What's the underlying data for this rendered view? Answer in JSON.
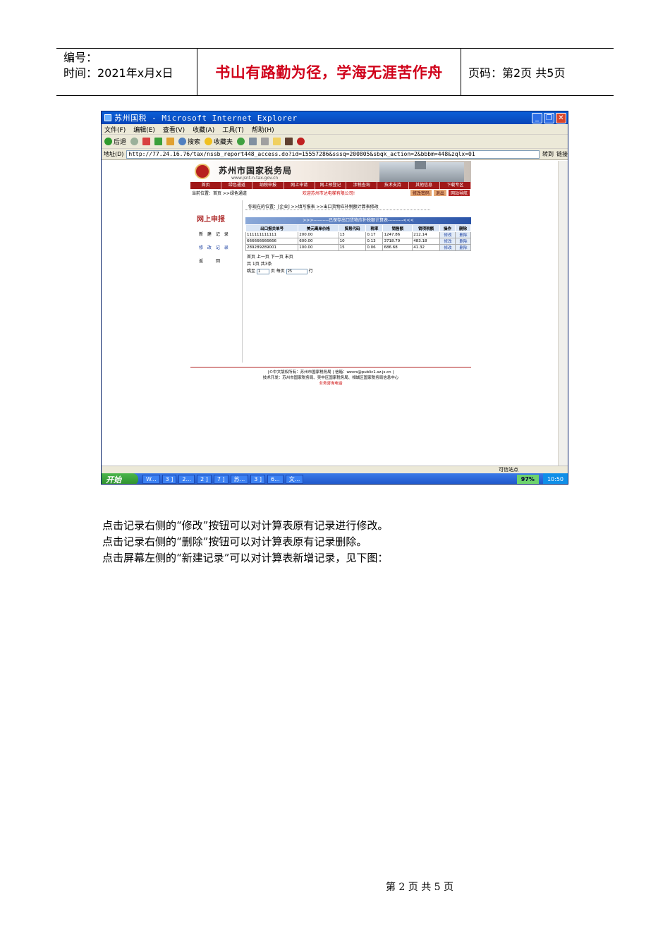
{
  "header": {
    "number_label": "编号：",
    "time_label": "时间：2021年x月x日",
    "motto": "书山有路勤为径，学海无涯苦作舟",
    "page_label": "页码：第2页  共5页"
  },
  "browser": {
    "title": "苏州国税 - Microsoft Internet Explorer",
    "menu": [
      "文件(F)",
      "编辑(E)",
      "查看(V)",
      "收藏(A)",
      "工具(T)",
      "帮助(H)"
    ],
    "toolbar": {
      "back": "后退",
      "search": "搜索",
      "favorites": "收藏夹"
    },
    "address_label": "地址(D)",
    "address": "http://77.24.16.76/tax/nssb_report448_access.do?id=15557286&sssq=200805&sbqk_action=2&bbbm=448&zqlx=01",
    "go_label": "转到",
    "links_label": "链接",
    "status": "可信站点",
    "taskbar": {
      "start": "开始",
      "items": [
        "W...",
        "3 ]",
        "2...",
        "2 ]",
        "7 ]",
        "苏...",
        "3 ]",
        "6...",
        "文..."
      ],
      "zoom": "97%",
      "clock": "10:50"
    }
  },
  "site": {
    "name": "苏州市国家税务局",
    "url": "www.jsnt-n-tax.gov.cn",
    "nav": [
      "首页",
      "绿色通道",
      "纳税申报",
      "网上申请",
      "网上预登记",
      "涉税查询",
      "技术支持",
      "其他信息",
      "下载专区"
    ],
    "location": "当前位置：首页 >>绿色通道",
    "welcome": "欢迎苏州市达电梯有限公司!",
    "btn_modify_pwd": "修改密码",
    "btn_exit": "退出",
    "btn_site_nav": "网站导航",
    "side_title": "网上申报",
    "side_links": [
      "新 建 记 录",
      "修 改 记 录",
      "返　　回"
    ],
    "crumb": "你现在的位置：[企业] >>填写报表 >>出口货物应补税额计算表修改",
    "table_title": ">>>----------已保存出口货物应补税额计算表----------<<<",
    "columns": [
      "出口报关单号",
      "美元离岸价格",
      "贸易代码",
      "税率",
      "销售额",
      "销项税额",
      "操作",
      "删除"
    ],
    "rows": [
      [
        "111111111111",
        "200.00",
        "13",
        "0.17",
        "1247.86",
        "212.14",
        "修改",
        "删除"
      ],
      [
        "666666666666",
        "600.00",
        "10",
        "0.13",
        "3718.79",
        "483.18",
        "修改",
        "删除"
      ],
      [
        "289289289001",
        "100.00",
        "15",
        "0.06",
        "686.68",
        "41.32",
        "修改",
        "删除"
      ]
    ],
    "pager_links": "首页  上一页  下一页  末页",
    "pager_info": "共 1页 共3条",
    "jump_label": "跳至",
    "jump_value": "1",
    "page_unit": "页",
    "per_page_label": "每页",
    "per_page_value": "25",
    "row_unit": "行",
    "footer_line1": "|©中文版权所有：苏州市国家税务局 | 信箱：wzxrs@public1.sz.js.cn |",
    "footer_line2": "技术开发：苏州市国家税务局、吴中区国家税务局、相城区国家税务局信息中心",
    "footer_line3": "业务咨询电话"
  },
  "body": {
    "line1": "点击记录右侧的“修改”按钮可以对计算表原有记录进行修改。",
    "line2": "点击记录右侧的“删除”按钮可以对计算表原有记录删除。",
    "line3": "点击屏幕左侧的“新建记录”可以对计算表新增记录，见下图："
  },
  "footer": {
    "page": "第 2 页 共 5 页"
  }
}
